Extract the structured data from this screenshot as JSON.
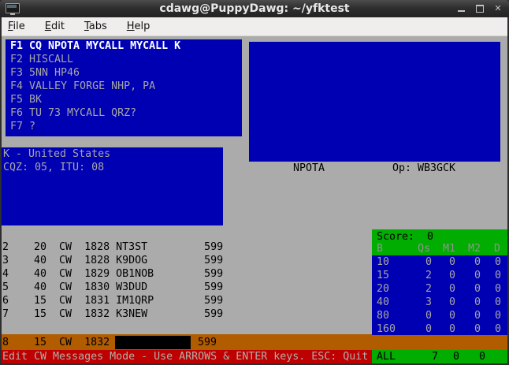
{
  "window": {
    "title": "cdawg@PuppyDawg: ~/yfktest",
    "close_glyph": "✕"
  },
  "menu": {
    "items": [
      {
        "label": "File"
      },
      {
        "label": "Edit"
      },
      {
        "label": "Tabs"
      },
      {
        "label": "Help"
      }
    ]
  },
  "macros": {
    "lines": [
      "F1 CQ NPOTA MYCALL MYCALL K",
      "F2 HISCALL",
      "F3 5NN HP46",
      "F4 VALLEY FORGE NHP, PA",
      "F5 BK",
      "F6 TU 73 MYCALL QRZ?",
      "F7 ?"
    ]
  },
  "dxinfo": {
    "lines": [
      "K - United States",
      "CQZ: 05, ITU: 08"
    ]
  },
  "contest": {
    "name": "NPOTA",
    "operator": "Op: WB3GCK"
  },
  "log": {
    "rows": [
      "2    20  CW  1828 NT3ST         599",
      "3    40  CW  1828 K9DOG         599",
      "4    40  CW  1829 OB1NOB        599",
      "5    40  CW  1830 W3DUD         599",
      "6    15  CW  1831 IM1QRP        599",
      "7    15  CW  1832 K3NEW         599"
    ]
  },
  "entry": {
    "prefix": "8    15  CW  1832",
    "callsign_value": "",
    "rst": "599"
  },
  "score": {
    "title": "Score:  0",
    "headers": [
      "B",
      "Qs",
      "M1",
      "M2",
      "D"
    ],
    "rows": [
      {
        "band": "10",
        "qs": "0",
        "m1": "0",
        "m2": "0",
        "d": "0"
      },
      {
        "band": "15",
        "qs": "2",
        "m1": "0",
        "m2": "0",
        "d": "0"
      },
      {
        "band": "20",
        "qs": "2",
        "m1": "0",
        "m2": "0",
        "d": "0"
      },
      {
        "band": "40",
        "qs": "3",
        "m1": "0",
        "m2": "0",
        "d": "0"
      },
      {
        "band": "80",
        "qs": "0",
        "m1": "0",
        "m2": "0",
        "d": "0"
      },
      {
        "band": "160",
        "qs": "0",
        "m1": "0",
        "m2": "0",
        "d": "0"
      }
    ],
    "all": {
      "label": "ALL",
      "qs": "7",
      "m1": "0",
      "m2": "0"
    }
  },
  "statusbar": {
    "message": "Edit CW Messages Mode - Use ARROWS & ENTER keys. ESC: Quit"
  },
  "colors": {
    "panel_blue": "#0000b3",
    "terminal_gray": "#ababab",
    "entry_orange": "#b25c00",
    "status_red": "#be0000",
    "score_green": "#00ad00",
    "dim_white": "#a6a6a6"
  }
}
